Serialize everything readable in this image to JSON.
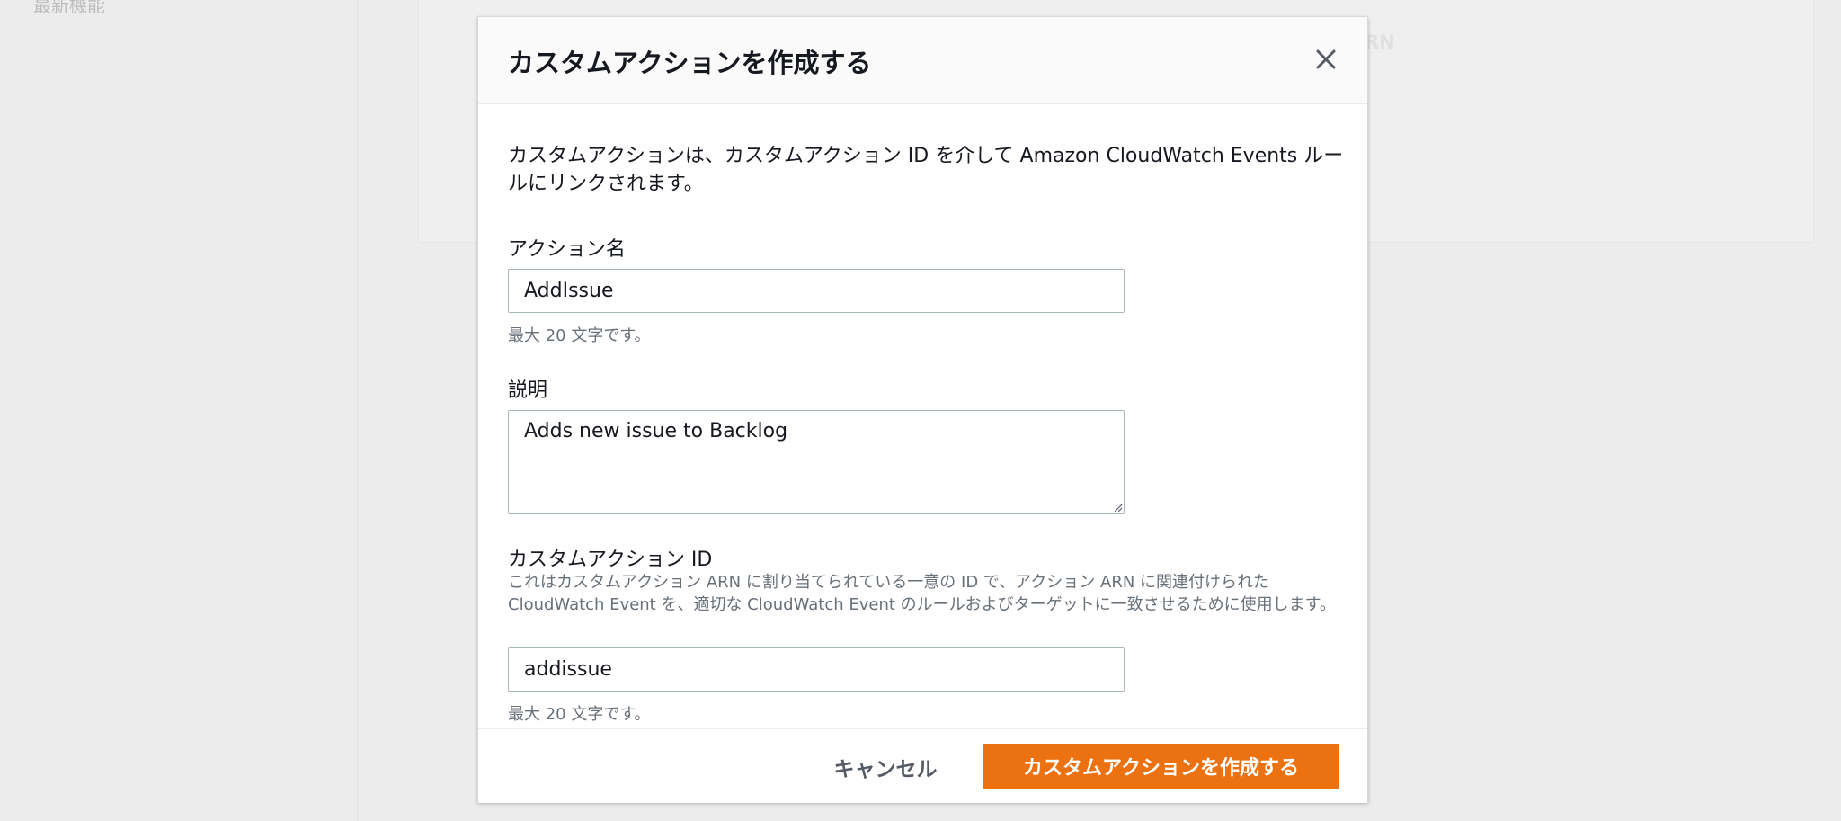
{
  "background": {
    "sidebar_item": "最新機能",
    "panel_text": "RN"
  },
  "modal": {
    "title": "カスタムアクションを作成する",
    "intro": "カスタムアクションは、カスタムアクション ID を介して Amazon CloudWatch Events ルールにリンクされます。",
    "action_name": {
      "label": "アクション名",
      "value": "AddIssue",
      "hint": "最大 20 文字です。"
    },
    "description": {
      "label": "説明",
      "value": "Adds new issue to Backlog"
    },
    "custom_action_id": {
      "label": "カスタムアクション ID",
      "description": "これはカスタムアクション ARN に割り当てられている一意の ID で、アクション ARN に関連付けられた CloudWatch Event を、適切な CloudWatch Event のルールおよびターゲットに一致させるために使用します。",
      "value": "addissue",
      "hint": "最大 20 文字です。"
    },
    "footer": {
      "cancel_label": "キャンセル",
      "create_label": "カスタムアクションを作成する"
    }
  },
  "colors": {
    "primary_button": "#ec7211",
    "text": "#16191f",
    "hint_text": "#687078"
  }
}
